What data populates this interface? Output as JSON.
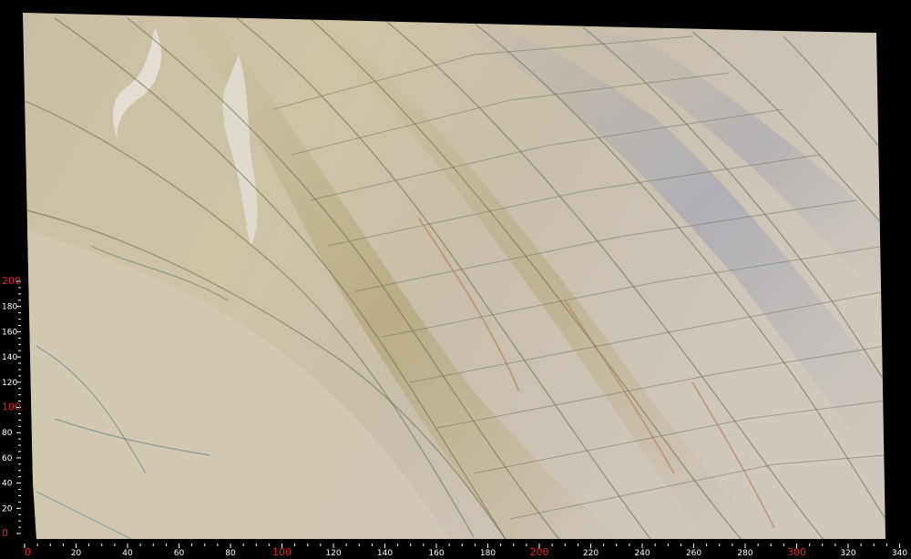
{
  "image": {
    "subject": "marble-slab",
    "colors": {
      "background": "#000000",
      "slab_base": "#cfc4ab",
      "slab_warm": "#b8a780",
      "vein_dark": "#5f6b4e",
      "vein_blue": "#7c86a8",
      "vein_rust": "#b87a55",
      "tick_minor": "#ffffff",
      "tick_major": "#e8202a"
    }
  },
  "x_ruler": {
    "labels": [
      "0",
      "20",
      "40",
      "60",
      "80",
      "100",
      "120",
      "140",
      "160",
      "180",
      "200",
      "220",
      "240",
      "260",
      "280",
      "300",
      "320",
      "340"
    ],
    "major": [
      "0",
      "100",
      "200",
      "300"
    ]
  },
  "y_ruler": {
    "labels": [
      "0",
      "20",
      "40",
      "60",
      "80",
      "100",
      "120",
      "140",
      "160",
      "180",
      "200"
    ],
    "major": [
      "0",
      "100",
      "200"
    ]
  }
}
